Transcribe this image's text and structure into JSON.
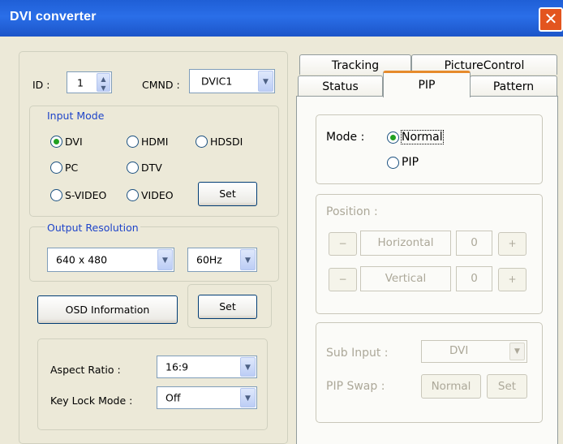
{
  "window": {
    "title": "DVI converter",
    "close_symbol": "✕"
  },
  "left": {
    "id_label": "ID :",
    "id_value": "1",
    "cmnd_label": "CMND :",
    "cmnd_value": "DVIC1",
    "input_mode": {
      "title": "Input Mode",
      "options": [
        "DVI",
        "HDMI",
        "HDSDI",
        "PC",
        "DTV",
        "S-VIDEO",
        "VIDEO"
      ],
      "selected": "DVI",
      "set_label": "Set"
    },
    "output_resolution": {
      "title": "Output Resolution",
      "resolution": "640 x 480",
      "refresh": "60Hz"
    },
    "osd_label": "OSD  Information",
    "output_set_label": "Set",
    "aspect_label": "Aspect Ratio :",
    "aspect_value": "16:9",
    "keylock_label": "Key Lock Mode :",
    "keylock_value": "Off"
  },
  "tabs": {
    "row1": [
      "Tracking",
      "PictureControl"
    ],
    "row2": [
      "Status",
      "PIP",
      "Pattern"
    ],
    "active": "PIP"
  },
  "pip": {
    "mode_label": "Mode :",
    "mode_options": [
      "Normal",
      "PIP"
    ],
    "mode_selected": "Normal",
    "position_label": "Position :",
    "horizontal_label": "Horizontal",
    "horizontal_value": "0",
    "vertical_label": "Vertical",
    "vertical_value": "0",
    "minus": "−",
    "plus": "+",
    "sub_input_label": "Sub Input :",
    "sub_input_value": "DVI",
    "pip_swap_label": "PIP Swap :",
    "swap_normal_label": "Normal",
    "swap_set_label": "Set"
  }
}
